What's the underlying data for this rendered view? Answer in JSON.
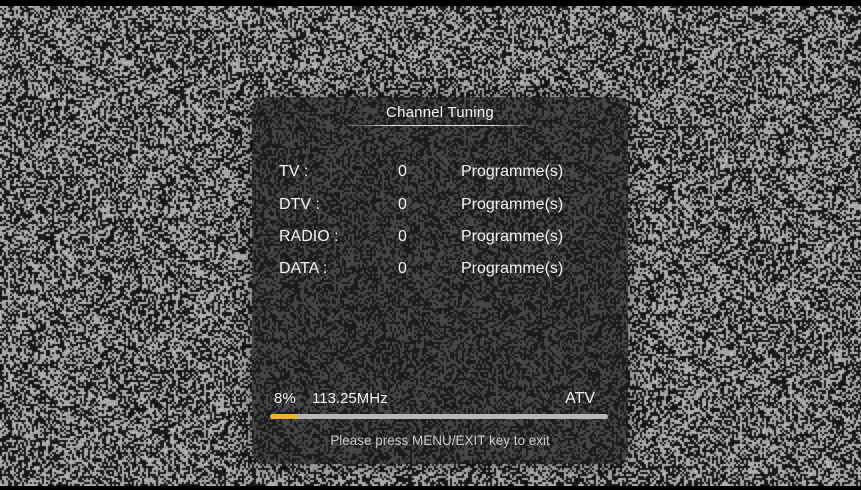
{
  "dialog": {
    "title": "Channel Tuning",
    "counts": [
      {
        "label": "TV :",
        "value": "0",
        "unit": "Programme(s)"
      },
      {
        "label": "DTV :",
        "value": "0",
        "unit": "Programme(s)"
      },
      {
        "label": "RADIO :",
        "value": "0",
        "unit": "Programme(s)"
      },
      {
        "label": "DATA :",
        "value": "0",
        "unit": "Programme(s)"
      }
    ],
    "scan": {
      "progress_text": "8%",
      "frequency": "113.25MHz",
      "mode": "ATV",
      "progress_fraction": 0.08
    },
    "hint": "Please press MENU/EXIT key to exit"
  },
  "colors": {
    "progress_fill": "#f0b62a",
    "progress_track": "#b7b7b7",
    "panel": "#1c1c1c"
  }
}
